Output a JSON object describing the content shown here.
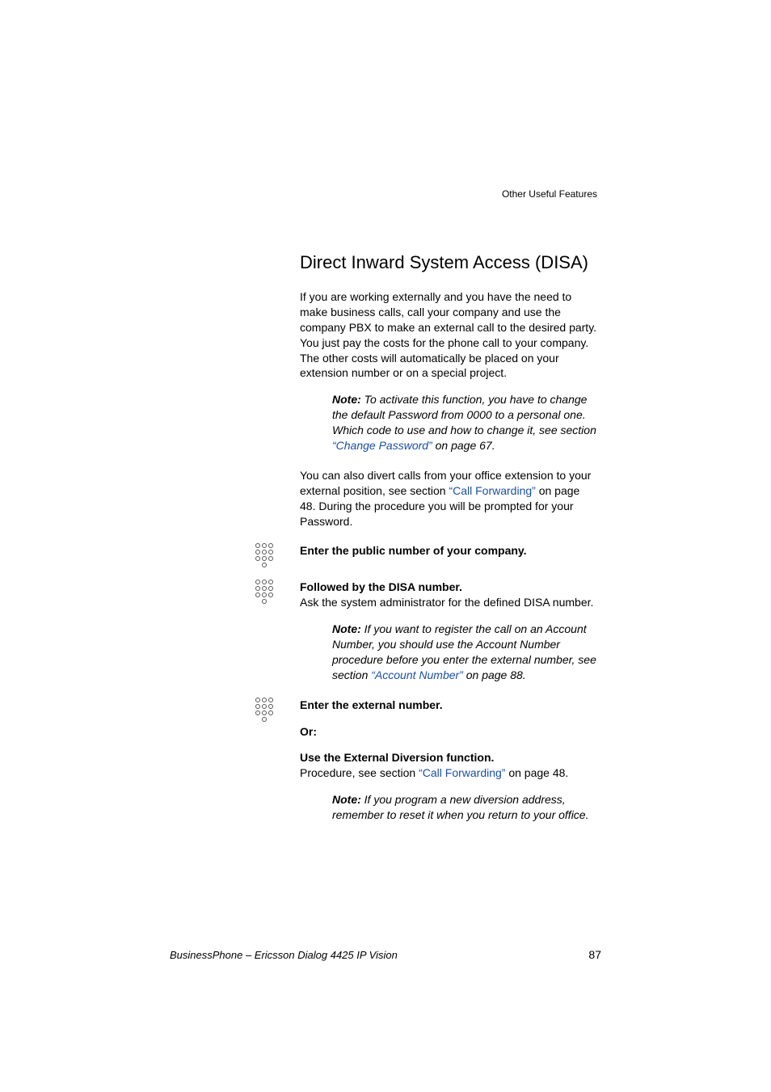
{
  "running_header": "Other Useful Features",
  "title": "Direct Inward System Access (DISA)",
  "intro": "If you are working externally and you have the need to make business calls, call your company and use the company PBX to make an external call to the desired party. You just pay the costs for the phone call to your company. The other costs will automatically be placed on your extension number or on a special project.",
  "note1": {
    "label": "Note:",
    "before_link": " To activate this function, you have to change the default Password from 0000 to a personal one. Which code to use and how to change it, see section ",
    "link": "“Change Password”",
    "after_link": " on page 67."
  },
  "divert": {
    "before_link": "You can also divert calls from your office extension to your external position, see section ",
    "link": "“Call Forwarding”",
    "after_link": " on page 48. During the procedure you will be prompted for your Password."
  },
  "step1": "Enter the public number of your company.",
  "step2_title": "Followed by the DISA number.",
  "step2_sub": "Ask the system administrator for the defined DISA number.",
  "note2": {
    "label": "Note: ",
    "before_link": " If you want to register the call on an Account Number, you should use the Account Number procedure before you enter the external number, see section ",
    "link": "“Account Number”",
    "after_link": " on page 88."
  },
  "step3": "Enter the external number.",
  "or": "Or:",
  "ext_div_title": "Use the External Diversion function.",
  "ext_div_sub_before": "Procedure, see section ",
  "ext_div_link": "“Call Forwarding”",
  "ext_div_sub_after": " on page 48.",
  "note3": {
    "label": "Note:",
    "text": " If you program a new diversion address, remember to reset it when you return to your office."
  },
  "footer_left": "BusinessPhone – Ericsson Dialog 4425 IP Vision",
  "footer_right": "87"
}
